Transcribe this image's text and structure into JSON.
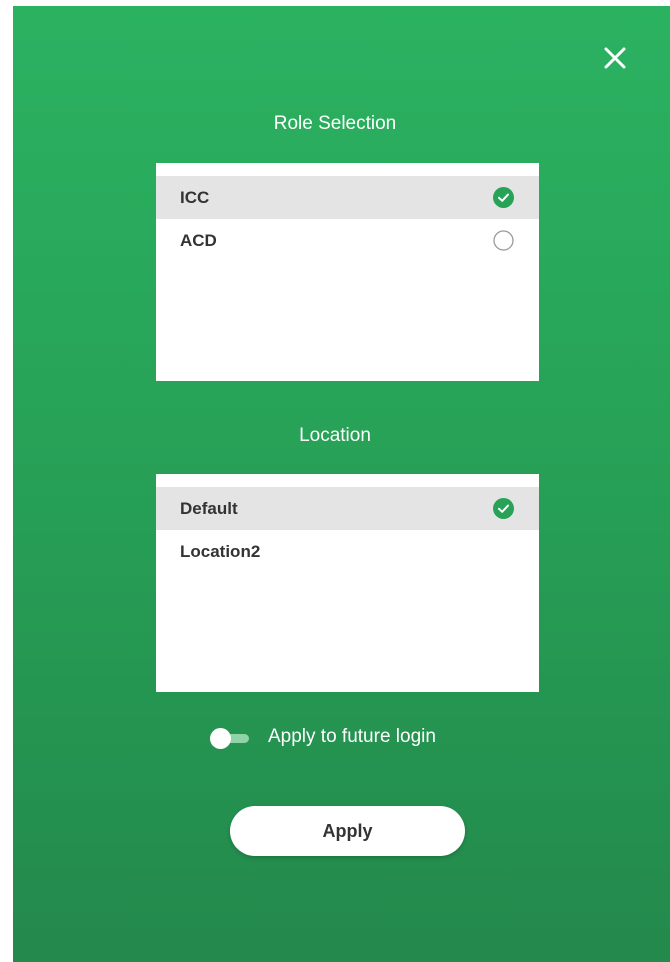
{
  "dialog": {
    "close_icon": "close-icon",
    "colors": {
      "background_top": "#2bb261",
      "background_bottom": "#23894c",
      "selected_row": "#e4e4e4",
      "check": "#27a257"
    }
  },
  "role_section": {
    "title": "Role Selection",
    "items": [
      {
        "label": "ICC",
        "selected": true,
        "icon": "check-circle-icon"
      },
      {
        "label": "ACD",
        "selected": false,
        "icon": "radio-empty-icon"
      }
    ]
  },
  "location_section": {
    "title": "Location",
    "items": [
      {
        "label": "Default",
        "selected": true,
        "icon": "check-circle-icon"
      },
      {
        "label": "Location2",
        "selected": false
      }
    ]
  },
  "future_login": {
    "label": "Apply to future login",
    "enabled": false
  },
  "apply_button": {
    "label": "Apply"
  }
}
